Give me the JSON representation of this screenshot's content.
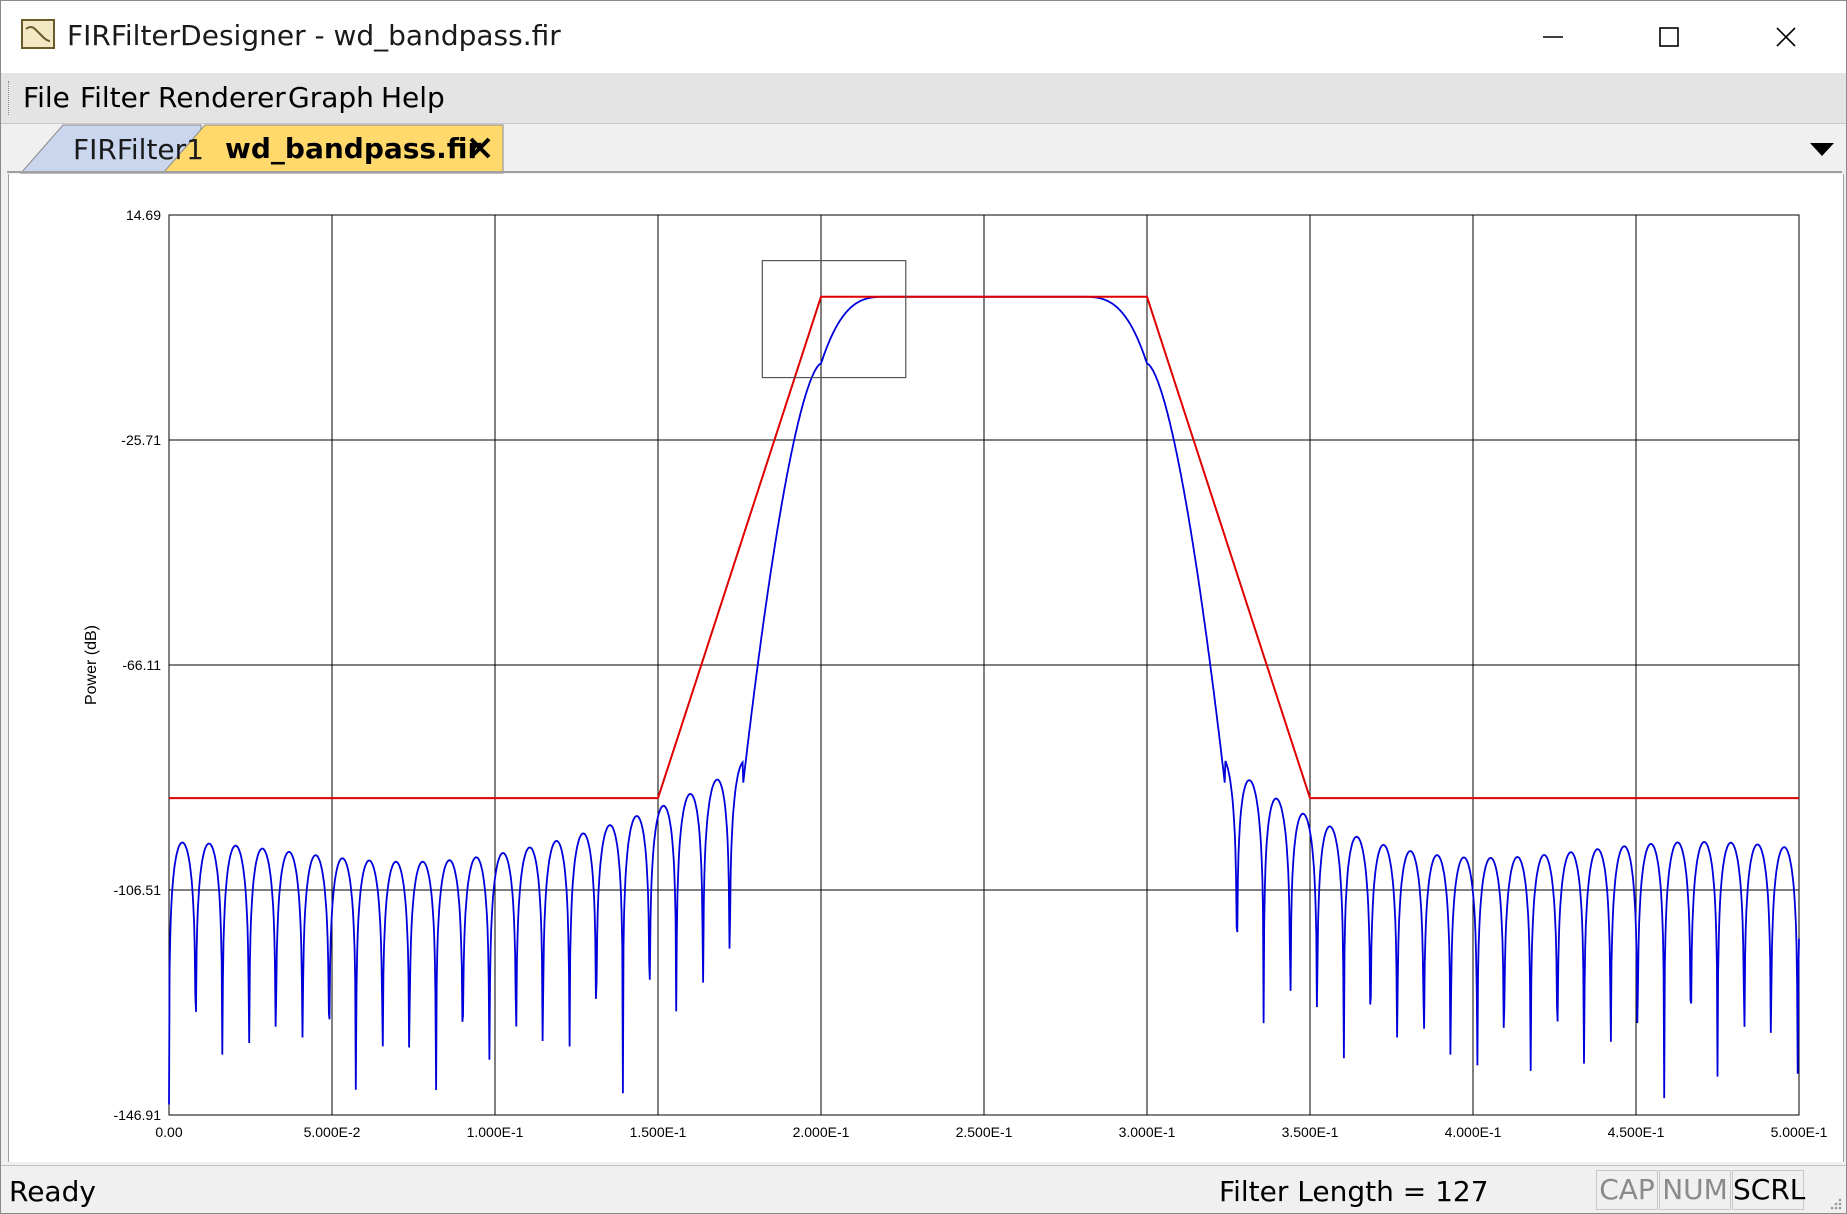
{
  "window": {
    "title": "FIRFilterDesigner - wd_bandpass.fir"
  },
  "menu": [
    "File",
    "Filter",
    "Renderer",
    "Graph",
    "Help"
  ],
  "tabs": [
    {
      "label": "FIRFilter1",
      "active": false
    },
    {
      "label": "wd_bandpass.fir",
      "active": true
    }
  ],
  "status": {
    "text": "Ready",
    "filter_length": "Filter Length = 127",
    "indicators": [
      {
        "label": "CAP",
        "active": false
      },
      {
        "label": "NUM",
        "active": false
      },
      {
        "label": "SCRL",
        "active": true
      }
    ]
  },
  "colors": {
    "response": "#0000dd",
    "mask": "#e00000",
    "grid": "#000000",
    "active_tab": "#ffd96b",
    "inactive_tab": "#c9d6ee"
  },
  "chart_data": {
    "type": "line",
    "ylabel": "Power (dB)",
    "xlim": [
      0,
      0.5
    ],
    "ylim": [
      -146.91,
      14.69
    ],
    "y_ticks": [
      14.69,
      -25.71,
      -66.11,
      -106.51,
      -146.91
    ],
    "y_tick_labels": [
      "14.69",
      "-25.71",
      "-66.11",
      "-106.51",
      "-146.91"
    ],
    "x_ticks": [
      0,
      0.05,
      0.1,
      0.15,
      0.2,
      0.25,
      0.3,
      0.35,
      0.4,
      0.45,
      0.5
    ],
    "x_tick_labels": [
      "0.00",
      "5.000E-2",
      "1.000E-1",
      "1.500E-1",
      "2.000E-1",
      "2.500E-1",
      "3.000E-1",
      "3.500E-1",
      "4.000E-1",
      "4.500E-1",
      "5.000E-1"
    ],
    "grid": true,
    "series": [
      {
        "role": "mask",
        "color": "#e00000",
        "x": [
          0,
          0.15,
          0.2,
          0.3,
          0.35,
          0.5
        ],
        "y": [
          -90,
          -90,
          0,
          0,
          -90,
          -90
        ]
      },
      {
        "role": "response",
        "color": "#0000dd",
        "passband_db": 0,
        "stopband_peak_db": [
          -100,
          -85
        ],
        "stopband_null_db": -145,
        "nulls": 55
      }
    ],
    "zoom_box": {
      "x": [
        0.182,
        0.226
      ],
      "y": [
        6.5,
        -14.5
      ]
    }
  }
}
